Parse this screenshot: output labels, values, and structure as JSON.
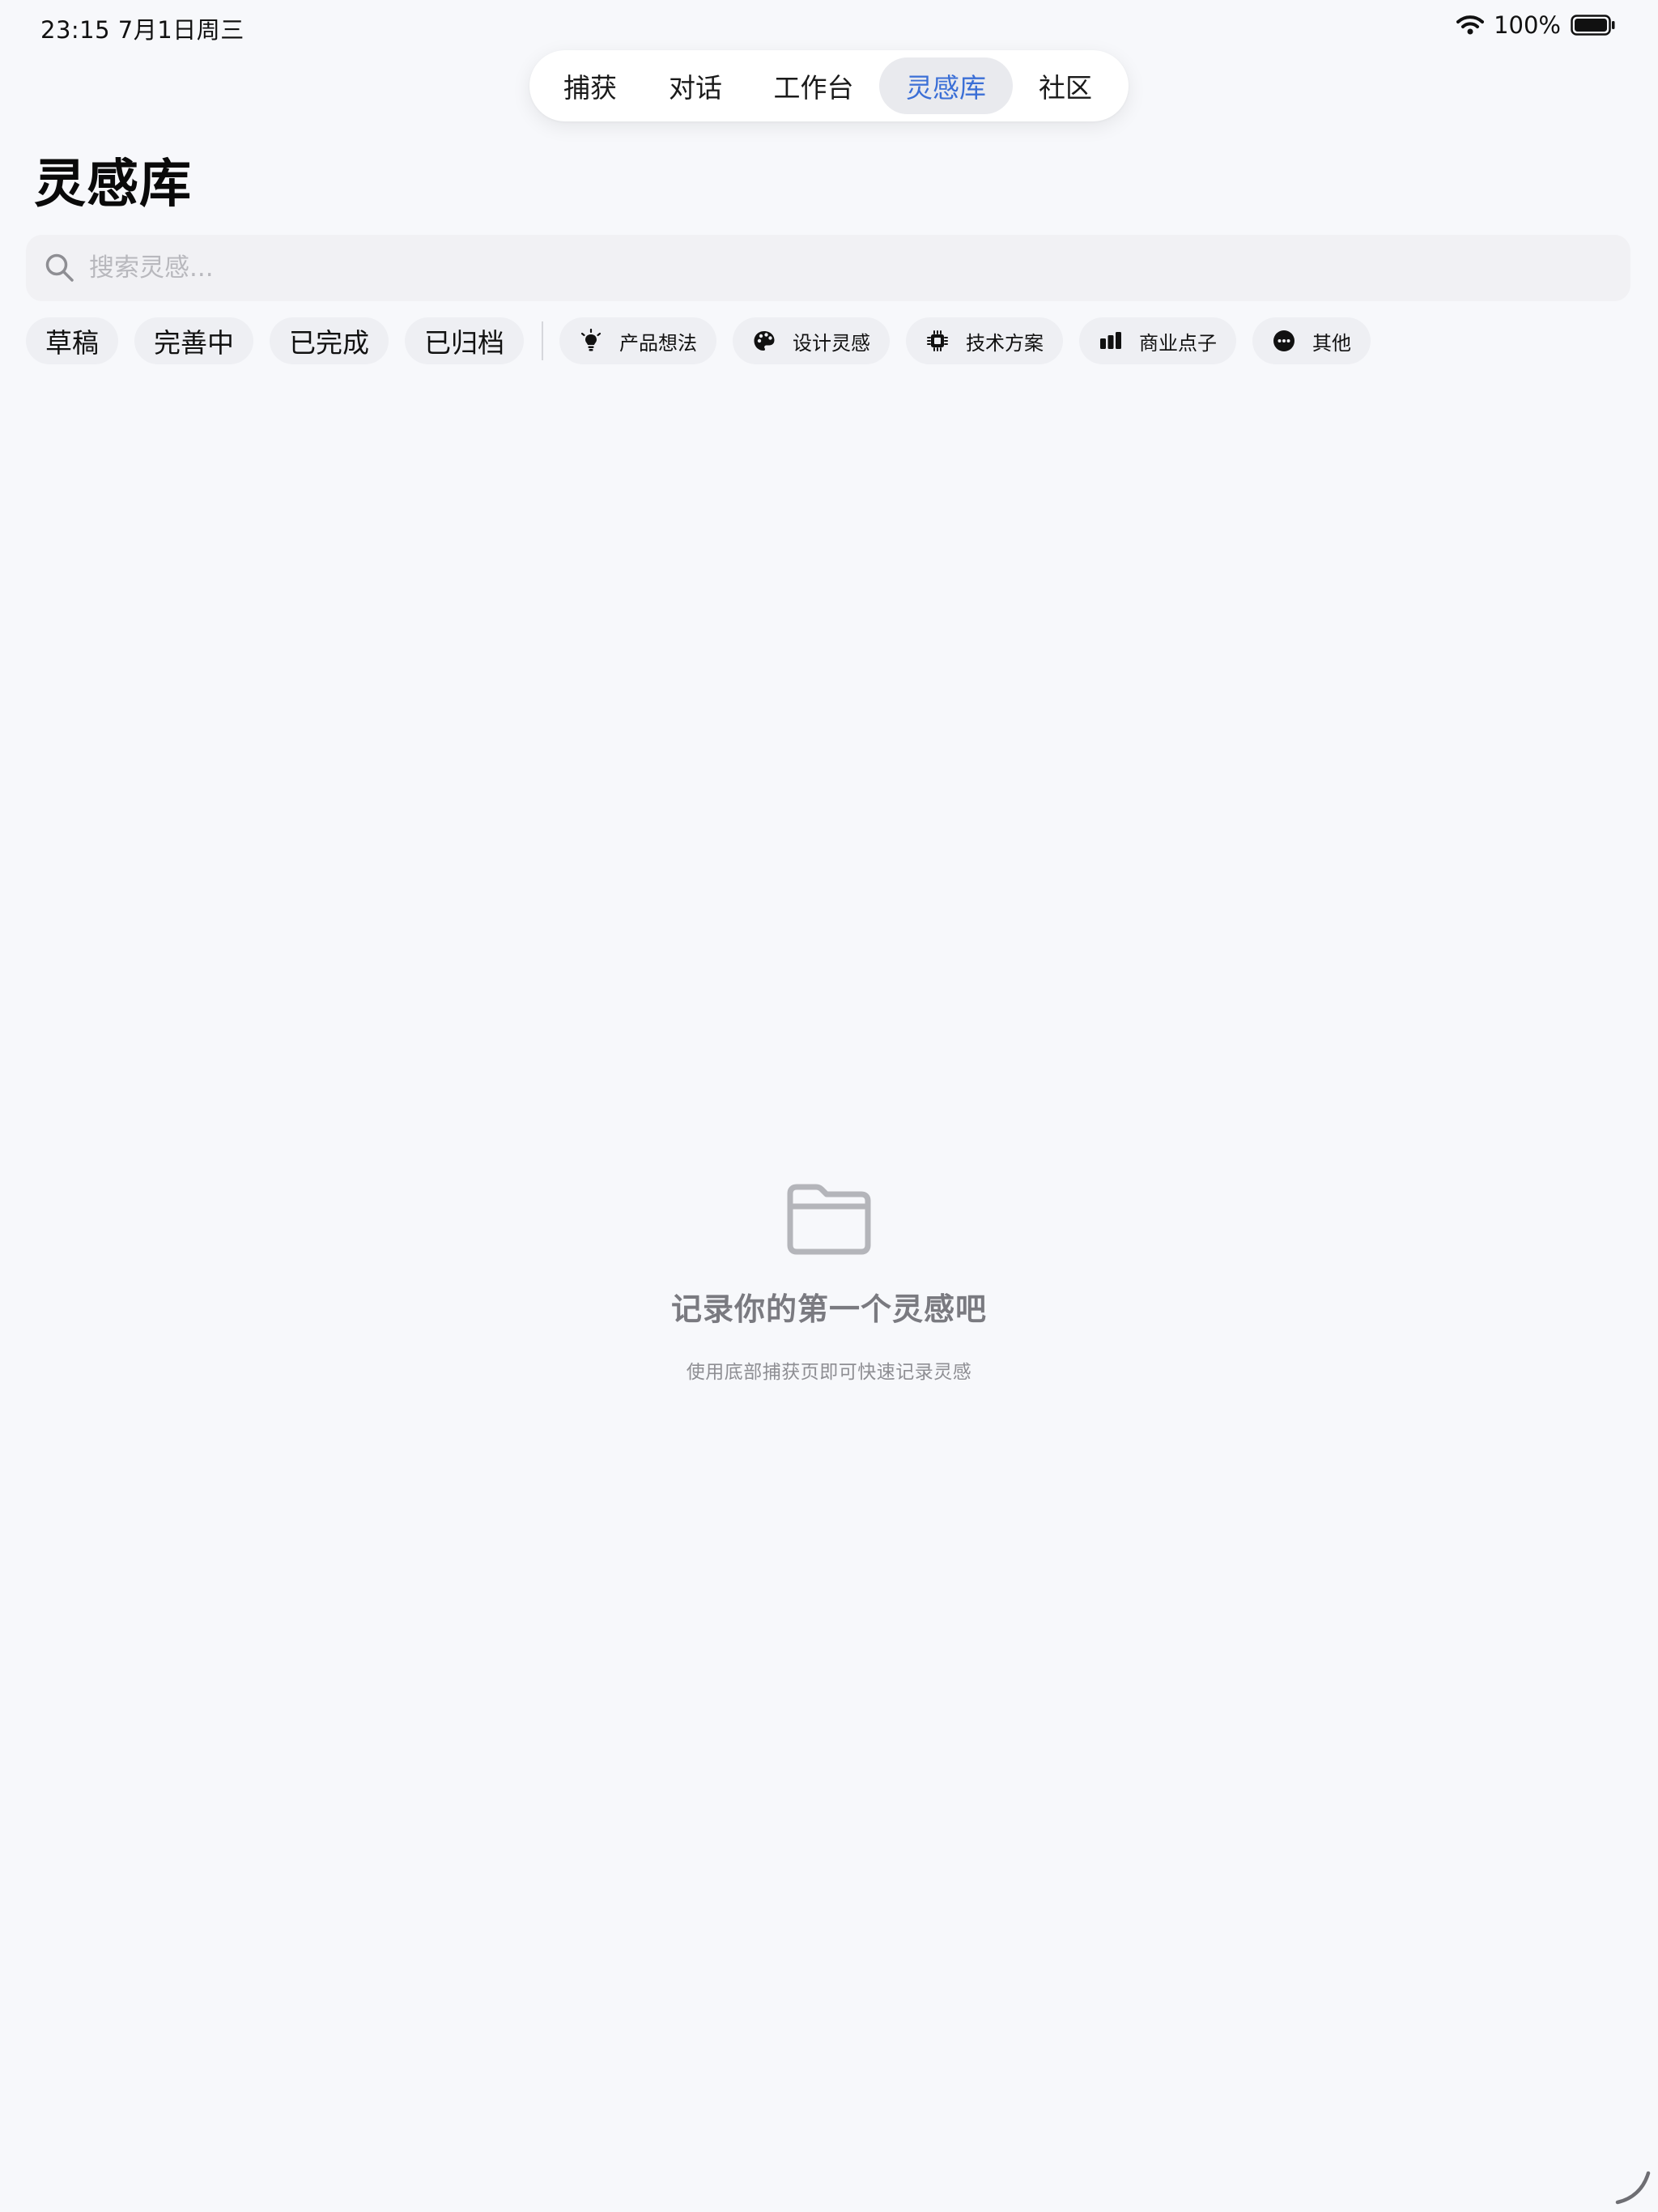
{
  "status_bar": {
    "time_date": "23:15  7月1日周三",
    "battery": "100%"
  },
  "tabs": [
    {
      "label": "捕获",
      "active": false
    },
    {
      "label": "对话",
      "active": false
    },
    {
      "label": "工作台",
      "active": false
    },
    {
      "label": "灵感库",
      "active": true
    },
    {
      "label": "社区",
      "active": false
    }
  ],
  "page": {
    "title": "灵感库"
  },
  "search": {
    "placeholder": "搜索灵感...",
    "value": ""
  },
  "status_filters": [
    "草稿",
    "完善中",
    "已完成",
    "已归档"
  ],
  "category_filters": [
    {
      "label": "产品想法",
      "icon": "lightbulb-icon"
    },
    {
      "label": "设计灵感",
      "icon": "palette-icon"
    },
    {
      "label": "技术方案",
      "icon": "cpu-icon"
    },
    {
      "label": "商业点子",
      "icon": "chart-icon"
    },
    {
      "label": "其他",
      "icon": "more-icon"
    }
  ],
  "empty_state": {
    "icon": "folder-icon",
    "title": "记录你的第一个灵感吧",
    "subtitle": "使用底部捕获页即可快速记录灵感"
  },
  "colors": {
    "background": "#f7f8fb",
    "accent": "#3b6fd6",
    "chip_bg": "#eeeff3"
  }
}
